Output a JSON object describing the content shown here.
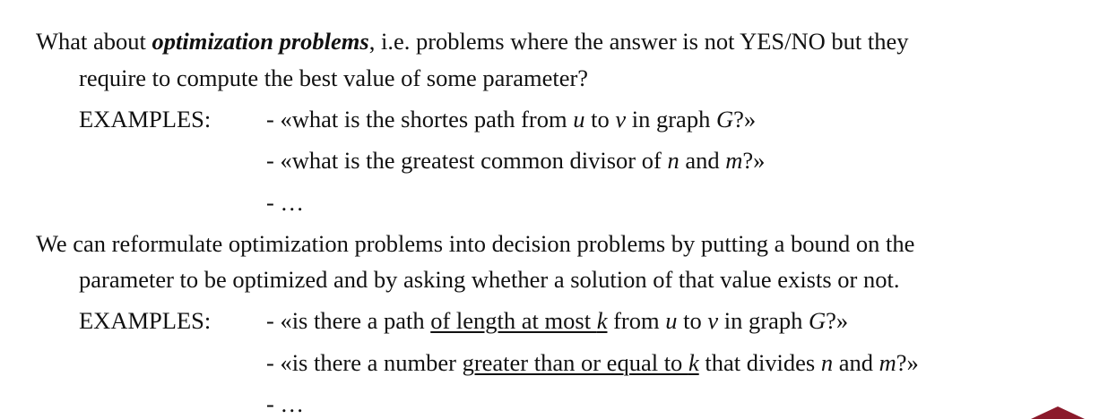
{
  "section1": {
    "intro": {
      "prefix": "What about ",
      "emphasis": "optimization problems",
      "suffix": ", i.e. problems where the answer is not YES/NO but they"
    },
    "continuation": "require to compute the best value of some parameter?",
    "examples_label": "EXAMPLES:",
    "examples": [
      {
        "p1": "- «what is the shortes path from ",
        "v1": "u",
        "p2": " to ",
        "v2": "v",
        "p3": " in graph ",
        "v3": "G",
        "p4": "?»"
      },
      {
        "p1": "- «what is the greatest common divisor of ",
        "v1": "n",
        "p2": " and ",
        "v2": "m",
        "p3": "?»"
      },
      {
        "text": "- …"
      }
    ]
  },
  "section2": {
    "intro": "We can reformulate optimization problems into decision problems by putting a bound on the",
    "continuation": "parameter to be optimized and by asking whether a solution of that value exists or not.",
    "examples_label": "EXAMPLES:",
    "examples": [
      {
        "p1": "- «is there a path ",
        "u1": "of length at most ",
        "uv": "k",
        "p2": " from ",
        "v1": "u",
        "p3": " to ",
        "v2": "v",
        "p4": " in graph ",
        "v3": "G",
        "p5": "?»"
      },
      {
        "p1": "- «is there a number ",
        "u1": "greater than or equal to ",
        "uv": "k",
        "p2": " that divides ",
        "v1": "n",
        "p3": " and ",
        "v2": "m",
        "p4": "?»"
      },
      {
        "text": "- …"
      }
    ]
  },
  "colors": {
    "text": "#111111",
    "corner_mark": "#8b1a2b"
  }
}
